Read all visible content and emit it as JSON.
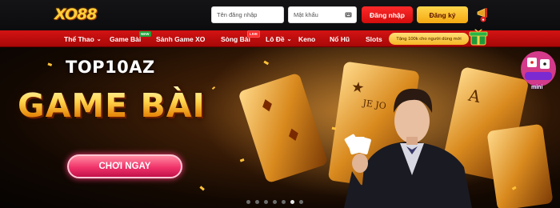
{
  "header": {
    "logo_text": "XO88",
    "username_placeholder": "Tên đăng nhập",
    "password_placeholder": "Mật khẩu",
    "login_label": "Đăng nhập",
    "register_label": "Đăng ký"
  },
  "nav": {
    "items": [
      {
        "label": "Thể Thao",
        "has_dropdown": true
      },
      {
        "label": "Game Bài",
        "badge": "NEW"
      },
      {
        "label": "Sảnh Game XO"
      },
      {
        "label": "Sòng Bài",
        "badge": "LIVE"
      },
      {
        "label": "Lô Đề",
        "has_dropdown": true
      },
      {
        "label": "Keno"
      },
      {
        "label": "Nổ Hũ"
      },
      {
        "label": "Slots"
      }
    ],
    "promo_text": "Tặng 100k cho người dùng mới"
  },
  "banner": {
    "brand": "TOP10AZ",
    "headline": "GAME BÀI",
    "cta_label": "CHƠI NGAY",
    "mini_label": "mini",
    "carousel": {
      "total": 7,
      "active_index": 5
    }
  },
  "colors": {
    "nav_red": "#c40d0d",
    "login_red": "#e81818",
    "register_gold": "#f8bf2a",
    "cta_pink": "#f0336a",
    "gold_text": "#ffd34a"
  },
  "icons": [
    "keyboard-icon",
    "horn-icon",
    "gift-icon",
    "chevron-down-icon",
    "mini-game-icon"
  ]
}
